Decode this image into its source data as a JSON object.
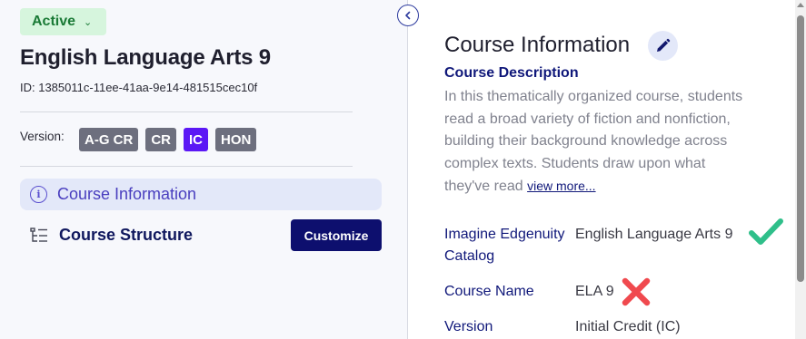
{
  "status": {
    "label": "Active"
  },
  "course": {
    "title": "English Language Arts 9",
    "id_text": "ID: 1385011c-11ee-41aa-9e14-481515cec10f"
  },
  "version": {
    "label": "Version:",
    "badges": [
      {
        "label": "A-G CR",
        "active": false
      },
      {
        "label": "CR",
        "active": false
      },
      {
        "label": "IC",
        "active": true
      },
      {
        "label": "HON",
        "active": false
      }
    ]
  },
  "nav": {
    "course_information": "Course Information",
    "course_structure": "Course Structure",
    "customize": "Customize"
  },
  "info": {
    "title": "Course Information",
    "description_heading": "Course Description",
    "description": "In this thematically organized course, students read a broad variety of fiction and nonfiction, building their background knowledge across complex texts. Students draw upon what they've read ",
    "view_more": "view more...",
    "fields": [
      {
        "label": "Imagine Edgenuity Catalog",
        "value": "English Language Arts 9",
        "status": "check"
      },
      {
        "label": "Course Name",
        "value": "ELA 9",
        "status": "cross"
      },
      {
        "label": "Version",
        "value": "Initial Credit (IC)",
        "status": "none"
      }
    ]
  },
  "colors": {
    "status_bg": "#d6f5dd",
    "status_text": "#1a7a36",
    "badge_default": "#6d6f7e",
    "badge_active": "#5b17f5",
    "customize_bg": "#0d0f6e",
    "check": "#2fbf8a",
    "cross": "#f0494e"
  }
}
